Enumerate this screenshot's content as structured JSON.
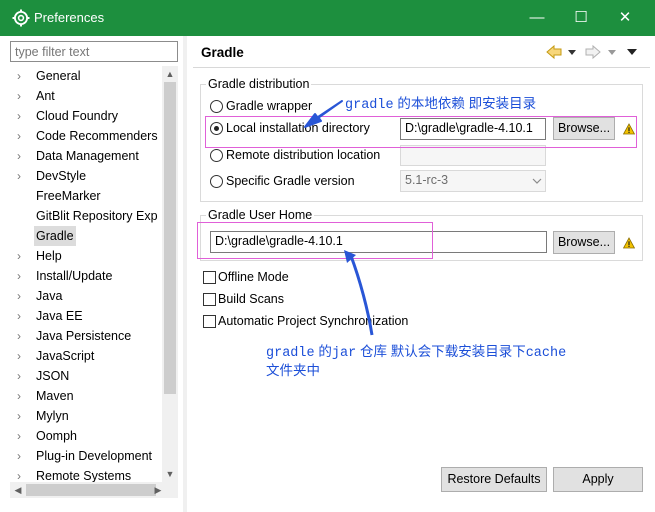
{
  "window": {
    "title": "Preferences",
    "minimize_glyph": "—",
    "maximize_glyph": "☐",
    "close_glyph": "✕"
  },
  "filter": {
    "placeholder": "type filter text",
    "value": ""
  },
  "tree": {
    "items": [
      {
        "label": "General",
        "expandable": true
      },
      {
        "label": "Ant",
        "expandable": true
      },
      {
        "label": "Cloud Foundry",
        "expandable": true
      },
      {
        "label": "Code Recommenders",
        "expandable": true
      },
      {
        "label": "Data Management",
        "expandable": true
      },
      {
        "label": "DevStyle",
        "expandable": true
      },
      {
        "label": "FreeMarker",
        "expandable": false
      },
      {
        "label": "GitBlit Repository Exp",
        "expandable": false
      },
      {
        "label": "Gradle",
        "expandable": false,
        "selected": true
      },
      {
        "label": "Help",
        "expandable": true
      },
      {
        "label": "Install/Update",
        "expandable": true
      },
      {
        "label": "Java",
        "expandable": true
      },
      {
        "label": "Java EE",
        "expandable": true
      },
      {
        "label": "Java Persistence",
        "expandable": true
      },
      {
        "label": "JavaScript",
        "expandable": true
      },
      {
        "label": "JSON",
        "expandable": true
      },
      {
        "label": "Maven",
        "expandable": true
      },
      {
        "label": "Mylyn",
        "expandable": true
      },
      {
        "label": "Oomph",
        "expandable": true
      },
      {
        "label": "Plug-in Development",
        "expandable": true
      },
      {
        "label": "Remote Systems",
        "expandable": true
      }
    ]
  },
  "page": {
    "title": "Gradle"
  },
  "distribution": {
    "group_label": "Gradle distribution",
    "wrapper_label": "Gradle wrapper",
    "local_label": "Local installation directory",
    "local_value": "D:\\gradle\\gradle-4.10.1",
    "remote_label": "Remote distribution location",
    "remote_value": "",
    "specific_label": "Specific Gradle version",
    "specific_value": "5.1-rc-3",
    "selected": "local",
    "browse_label": "Browse..."
  },
  "user_home": {
    "group_label": "Gradle User Home",
    "value": "D:\\gradle\\gradle-4.10.1",
    "browse_label": "Browse..."
  },
  "options": {
    "offline_label": "Offline Mode",
    "offline_checked": false,
    "build_scans_label": "Build Scans",
    "build_scans_checked": false,
    "auto_sync_label": "Automatic Project Synchronization",
    "auto_sync_checked": false
  },
  "buttons": {
    "restore_defaults": "Restore Defaults",
    "apply": "Apply"
  },
  "annotations": {
    "local_dir_code": "gradle",
    "local_dir_text": " 的本地依赖 即安装目录",
    "user_home_code1": "gradle",
    "user_home_text1": " 的",
    "user_home_code2": "jar",
    "user_home_text2": " 仓库 默认会下载安装目录下",
    "user_home_code3": "cache",
    "user_home_line2": "文件夹中"
  },
  "colors": {
    "titlebar": "#1d8f3e",
    "annotation_text": "#1c4fd8",
    "highlight_box": "#e060d8",
    "warning": "#f2c200"
  }
}
